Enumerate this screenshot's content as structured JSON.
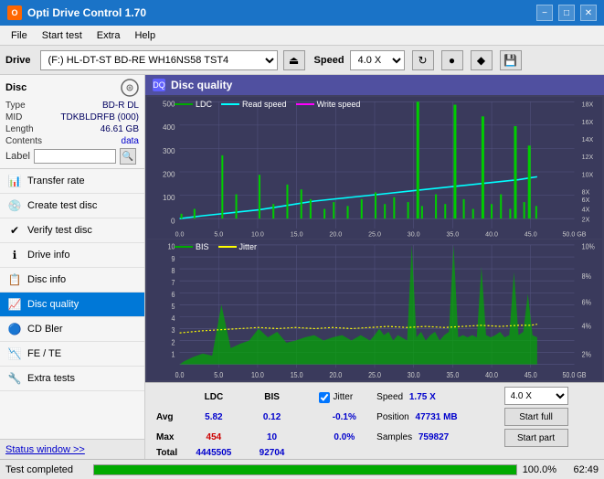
{
  "titlebar": {
    "title": "Opti Drive Control 1.70",
    "icon_label": "O",
    "minimize": "−",
    "maximize": "□",
    "close": "✕"
  },
  "menubar": {
    "items": [
      "File",
      "Start test",
      "Extra",
      "Help"
    ]
  },
  "drivebar": {
    "label": "Drive",
    "drive_value": "(F:)  HL-DT-ST BD-RE  WH16NS58 TST4",
    "eject_icon": "⏏",
    "speed_label": "Speed",
    "speed_value": "4.0 X",
    "btn1": "↻",
    "btn2": "●",
    "btn3": "◆",
    "btn4": "💾"
  },
  "disc_info": {
    "title": "Disc",
    "type_label": "Type",
    "type_value": "BD-R DL",
    "mid_label": "MID",
    "mid_value": "TDKBLDRFB (000)",
    "length_label": "Length",
    "length_value": "46.61 GB",
    "contents_label": "Contents",
    "contents_value": "data",
    "label_label": "Label",
    "label_value": ""
  },
  "nav_items": [
    {
      "id": "transfer-rate",
      "label": "Transfer rate",
      "icon": "📊"
    },
    {
      "id": "create-test-disc",
      "label": "Create test disc",
      "icon": "💿"
    },
    {
      "id": "verify-test-disc",
      "label": "Verify test disc",
      "icon": "✔"
    },
    {
      "id": "drive-info",
      "label": "Drive info",
      "icon": "ℹ"
    },
    {
      "id": "disc-info",
      "label": "Disc info",
      "icon": "📋"
    },
    {
      "id": "disc-quality",
      "label": "Disc quality",
      "icon": "📈",
      "active": true
    },
    {
      "id": "cd-bler",
      "label": "CD Bler",
      "icon": "🔵"
    },
    {
      "id": "fe-te",
      "label": "FE / TE",
      "icon": "📉"
    },
    {
      "id": "extra-tests",
      "label": "Extra tests",
      "icon": "🔧"
    }
  ],
  "statusbar": {
    "status_window_label": "Status window >>",
    "status_text": "Test completed",
    "progress": 100,
    "time": "62:49"
  },
  "disc_quality": {
    "title": "Disc quality",
    "chart1": {
      "legend": [
        {
          "label": "LDC",
          "color": "#00aa00"
        },
        {
          "label": "Read speed",
          "color": "#00ffff"
        },
        {
          "label": "Write speed",
          "color": "#ff00ff"
        }
      ],
      "y_max": 500,
      "y_labels": [
        "500",
        "400",
        "300",
        "200",
        "100",
        "0"
      ],
      "y_right_labels": [
        "18X",
        "16X",
        "14X",
        "12X",
        "10X",
        "8X",
        "6X",
        "4X",
        "2X"
      ],
      "x_labels": [
        "0.0",
        "5.0",
        "10.0",
        "15.0",
        "20.0",
        "25.0",
        "30.0",
        "35.0",
        "40.0",
        "45.0",
        "50.0 GB"
      ]
    },
    "chart2": {
      "legend": [
        {
          "label": "BIS",
          "color": "#00aa00"
        },
        {
          "label": "Jitter",
          "color": "#ffff00"
        }
      ],
      "y_max": 10,
      "y_labels": [
        "10",
        "9",
        "8",
        "7",
        "6",
        "5",
        "4",
        "3",
        "2",
        "1"
      ],
      "y_right_labels": [
        "10%",
        "8%",
        "6%",
        "4%",
        "2%"
      ],
      "x_labels": [
        "0.0",
        "5.0",
        "10.0",
        "15.0",
        "20.0",
        "25.0",
        "30.0",
        "35.0",
        "40.0",
        "45.0",
        "50.0 GB"
      ]
    }
  },
  "stats": {
    "col_ldc": "LDC",
    "col_bis": "BIS",
    "col_jitter_label": "Jitter",
    "jitter_checked": true,
    "avg_label": "Avg",
    "avg_ldc": "5.82",
    "avg_bis": "0.12",
    "avg_jitter": "-0.1%",
    "max_label": "Max",
    "max_ldc": "454",
    "max_bis": "10",
    "max_jitter": "0.0%",
    "total_label": "Total",
    "total_ldc": "4445505",
    "total_bis": "92704",
    "speed_label": "Speed",
    "speed_value": "1.75 X",
    "speed_select": "4.0 X",
    "position_label": "Position",
    "position_value": "47731 MB",
    "samples_label": "Samples",
    "samples_value": "759827",
    "start_full_label": "Start full",
    "start_part_label": "Start part"
  }
}
